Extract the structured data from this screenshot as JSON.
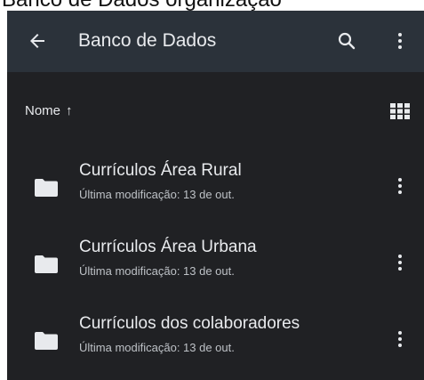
{
  "cropped_text": "Banco de Dados organização",
  "appbar": {
    "title": "Banco de Dados",
    "back_icon": "arrow-back-icon",
    "search_icon": "search-icon",
    "more_icon": "more-vert-icon"
  },
  "sort": {
    "label": "Nome",
    "direction_glyph": "↑",
    "view_toggle_icon": "grid-view-icon"
  },
  "folders": [
    {
      "name": "Currículos Área Rural",
      "modified": "Última modificação: 13 de out."
    },
    {
      "name": "Currículos Área Urbana",
      "modified": "Última modificação: 13 de out."
    },
    {
      "name": "Currículos dos colaboradores",
      "modified": "Última modificação: 13 de out."
    }
  ],
  "colors": {
    "background": "#202124",
    "appbar": "#2b323a",
    "text_primary": "#e8eaed",
    "text_secondary": "#bdc1c6",
    "folder_icon": "#e8eaed"
  }
}
